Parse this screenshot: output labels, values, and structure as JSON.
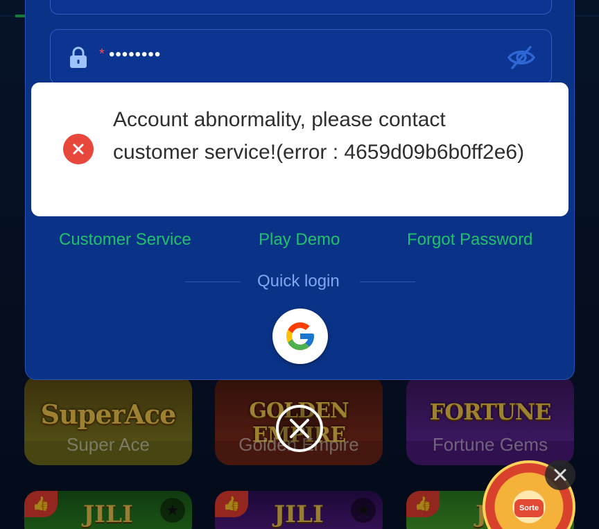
{
  "login": {
    "password_mask": "••••••••",
    "required_mark": "*"
  },
  "links": {
    "customer_service": "Customer Service",
    "play_demo": "Play Demo",
    "forgot_password": "Forgot Password"
  },
  "quick_login": {
    "label": "Quick login"
  },
  "toast": {
    "message": "Account abnormality, please contact customer service!(error : 4659d09b6b0ff2e6)"
  },
  "games": [
    {
      "name": "Super Ace",
      "logo": "SuperAce"
    },
    {
      "name": "Golden Empire",
      "logo": "GOLDEN EMPIRE"
    },
    {
      "name": "Fortune Gems",
      "logo": "FORTUNE"
    }
  ],
  "games_row2": [
    {
      "logo": "JILI"
    },
    {
      "logo": "JILI"
    },
    {
      "logo": "JI"
    }
  ],
  "wheel": {
    "label": "Sorte"
  },
  "colors": {
    "panel": "#0a3387",
    "link_green": "#1fc26a",
    "quick_login": "#7ea7ef",
    "error_red": "#e8473b"
  },
  "icons": [
    "lock-icon",
    "eye-off-icon",
    "google-icon",
    "close-icon",
    "error-icon",
    "thumbs-up-icon",
    "star-icon"
  ]
}
